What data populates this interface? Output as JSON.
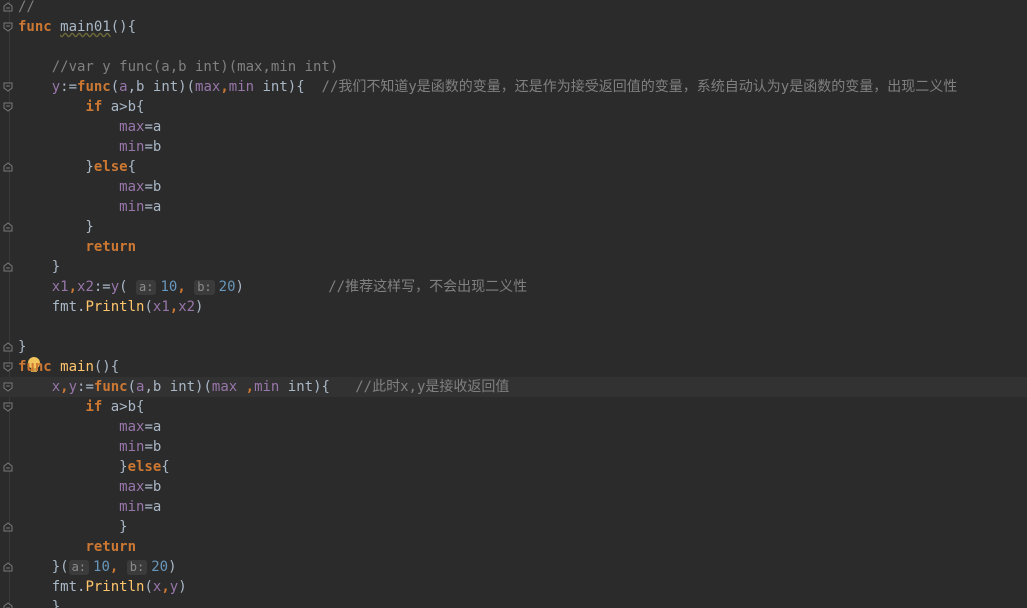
{
  "lines": [
    {
      "fold": "end",
      "tokens": [
        {
          "t": "//",
          "c": "cmt"
        }
      ]
    },
    {
      "fold": "start",
      "tokens": [
        {
          "t": "func",
          "c": "kw"
        },
        {
          "t": " ",
          "c": "plain"
        },
        {
          "t": "main01",
          "c": "plain warn"
        },
        {
          "t": "(){",
          "c": "plain"
        }
      ]
    },
    {
      "fold": "",
      "tokens": []
    },
    {
      "fold": "",
      "tokens": [
        {
          "t": "    //var y func(a,b int)(max,min int)",
          "c": "cmt"
        }
      ]
    },
    {
      "fold": "start",
      "tokens": [
        {
          "t": "    y",
          "c": "var"
        },
        {
          "t": ":=",
          "c": "plain"
        },
        {
          "t": "func",
          "c": "kw"
        },
        {
          "t": "(",
          "c": "plain"
        },
        {
          "t": "a",
          "c": "var"
        },
        {
          "t": ",b int)(",
          "c": "plain"
        },
        {
          "t": "max",
          "c": "var"
        },
        {
          "t": ",",
          "c": "kw"
        },
        {
          "t": "min",
          "c": "var"
        },
        {
          "t": " int){  ",
          "c": "plain"
        },
        {
          "t": "//我们不知道y是函数的变量，还是作为接受返回值的变量，系统自动认为y是函数的变量，出现二义性",
          "c": "cmt"
        }
      ]
    },
    {
      "fold": "start",
      "tokens": [
        {
          "t": "        ",
          "c": "plain"
        },
        {
          "t": "if",
          "c": "kw"
        },
        {
          "t": " a>b{",
          "c": "plain"
        }
      ]
    },
    {
      "fold": "",
      "tokens": [
        {
          "t": "            ",
          "c": "plain"
        },
        {
          "t": "max",
          "c": "var"
        },
        {
          "t": "=a",
          "c": "plain"
        }
      ]
    },
    {
      "fold": "",
      "tokens": [
        {
          "t": "            ",
          "c": "plain"
        },
        {
          "t": "min",
          "c": "var"
        },
        {
          "t": "=b",
          "c": "plain"
        }
      ]
    },
    {
      "fold": "end",
      "tokens": [
        {
          "t": "        }",
          "c": "plain"
        },
        {
          "t": "else",
          "c": "kw"
        },
        {
          "t": "{",
          "c": "plain"
        }
      ]
    },
    {
      "fold": "",
      "tokens": [
        {
          "t": "            ",
          "c": "plain"
        },
        {
          "t": "max",
          "c": "var"
        },
        {
          "t": "=b",
          "c": "plain"
        }
      ]
    },
    {
      "fold": "",
      "tokens": [
        {
          "t": "            ",
          "c": "plain"
        },
        {
          "t": "min",
          "c": "var"
        },
        {
          "t": "=a",
          "c": "plain"
        }
      ]
    },
    {
      "fold": "end",
      "tokens": [
        {
          "t": "        }",
          "c": "plain"
        }
      ]
    },
    {
      "fold": "",
      "tokens": [
        {
          "t": "        ",
          "c": "plain"
        },
        {
          "t": "return",
          "c": "kw"
        }
      ]
    },
    {
      "fold": "end",
      "tokens": [
        {
          "t": "    }",
          "c": "plain"
        }
      ]
    },
    {
      "fold": "",
      "tokens": [
        {
          "t": "    x1",
          "c": "var"
        },
        {
          "t": ",",
          "c": "kw"
        },
        {
          "t": "x2",
          "c": "var"
        },
        {
          "t": ":=",
          "c": "plain"
        },
        {
          "t": "y",
          "c": "var"
        },
        {
          "t": "( ",
          "c": "plain"
        },
        {
          "t": "a:",
          "c": "hint"
        },
        {
          "t": "10",
          "c": "num"
        },
        {
          "t": ", ",
          "c": "kw"
        },
        {
          "t": "b:",
          "c": "hint"
        },
        {
          "t": "20",
          "c": "num"
        },
        {
          "t": ")          ",
          "c": "plain"
        },
        {
          "t": "//推荐这样写，不会出现二义性",
          "c": "cmt"
        }
      ]
    },
    {
      "fold": "",
      "tokens": [
        {
          "t": "    fmt.",
          "c": "plain"
        },
        {
          "t": "Println",
          "c": "fn"
        },
        {
          "t": "(",
          "c": "plain"
        },
        {
          "t": "x1",
          "c": "var"
        },
        {
          "t": ",",
          "c": "kw"
        },
        {
          "t": "x2",
          "c": "var"
        },
        {
          "t": ")",
          "c": "plain"
        }
      ]
    },
    {
      "fold": "",
      "tokens": []
    },
    {
      "fold": "end",
      "tokens": [
        {
          "t": "}",
          "c": "plain"
        }
      ]
    },
    {
      "fold": "start",
      "bulb": true,
      "tokens": [
        {
          "t": "func",
          "c": "kw"
        },
        {
          "t": " ",
          "c": "plain"
        },
        {
          "t": "main",
          "c": "fn"
        },
        {
          "t": "(){",
          "c": "plain"
        }
      ]
    },
    {
      "fold": "start",
      "current": true,
      "tokens": [
        {
          "t": "    x",
          "c": "var"
        },
        {
          "t": ",",
          "c": "kw"
        },
        {
          "t": "y",
          "c": "var"
        },
        {
          "t": ":=",
          "c": "plain"
        },
        {
          "t": "func",
          "c": "kw"
        },
        {
          "t": "(",
          "c": "plain"
        },
        {
          "t": "a",
          "c": "var"
        },
        {
          "t": ",b int)(",
          "c": "plain"
        },
        {
          "t": "max ",
          "c": "var"
        },
        {
          "t": ",",
          "c": "kw"
        },
        {
          "t": "min",
          "c": "var"
        },
        {
          "t": " int){   ",
          "c": "plain"
        },
        {
          "t": "//此时x,y是接收返回值",
          "c": "cmt"
        }
      ]
    },
    {
      "fold": "start",
      "tokens": [
        {
          "t": "        ",
          "c": "plain"
        },
        {
          "t": "if",
          "c": "kw"
        },
        {
          "t": " a>b{",
          "c": "plain"
        }
      ]
    },
    {
      "fold": "",
      "tokens": [
        {
          "t": "            ",
          "c": "plain"
        },
        {
          "t": "max",
          "c": "var"
        },
        {
          "t": "=a",
          "c": "plain"
        }
      ]
    },
    {
      "fold": "",
      "tokens": [
        {
          "t": "            ",
          "c": "plain"
        },
        {
          "t": "min",
          "c": "var"
        },
        {
          "t": "=b",
          "c": "plain"
        }
      ]
    },
    {
      "fold": "end",
      "tokens": [
        {
          "t": "            }",
          "c": "plain"
        },
        {
          "t": "else",
          "c": "kw"
        },
        {
          "t": "{",
          "c": "plain"
        }
      ]
    },
    {
      "fold": "",
      "tokens": [
        {
          "t": "            ",
          "c": "plain"
        },
        {
          "t": "max",
          "c": "var"
        },
        {
          "t": "=b",
          "c": "plain"
        }
      ]
    },
    {
      "fold": "",
      "tokens": [
        {
          "t": "            ",
          "c": "plain"
        },
        {
          "t": "min",
          "c": "var"
        },
        {
          "t": "=a",
          "c": "plain"
        }
      ]
    },
    {
      "fold": "end",
      "tokens": [
        {
          "t": "            }",
          "c": "plain"
        }
      ]
    },
    {
      "fold": "",
      "tokens": [
        {
          "t": "        ",
          "c": "plain"
        },
        {
          "t": "return",
          "c": "kw"
        }
      ]
    },
    {
      "fold": "end",
      "tokens": [
        {
          "t": "    }(",
          "c": "plain"
        },
        {
          "t": "a:",
          "c": "hint"
        },
        {
          "t": "10",
          "c": "num"
        },
        {
          "t": ", ",
          "c": "kw"
        },
        {
          "t": "b:",
          "c": "hint"
        },
        {
          "t": "20",
          "c": "num"
        },
        {
          "t": ")",
          "c": "plain"
        }
      ]
    },
    {
      "fold": "",
      "tokens": [
        {
          "t": "    fmt.",
          "c": "plain"
        },
        {
          "t": "Println",
          "c": "fn"
        },
        {
          "t": "(",
          "c": "plain"
        },
        {
          "t": "x",
          "c": "var"
        },
        {
          "t": ",",
          "c": "kw"
        },
        {
          "t": "y",
          "c": "var"
        },
        {
          "t": ")",
          "c": "plain"
        }
      ]
    },
    {
      "fold": "end",
      "tokens": [
        {
          "t": "    }",
          "c": "plain"
        }
      ]
    }
  ]
}
